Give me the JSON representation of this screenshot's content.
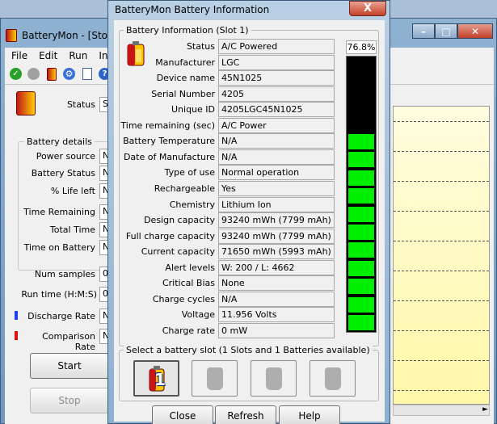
{
  "main": {
    "title": "BatteryMon - [Stop",
    "menu": [
      "File",
      "Edit",
      "Run",
      "Info"
    ],
    "status_label": "Status",
    "status_value": "S",
    "details_legend": "Battery details",
    "fields": [
      {
        "label": "Power source",
        "value": "N"
      },
      {
        "label": "Battery Status",
        "value": "N"
      },
      {
        "label": "% Life left",
        "value": "N"
      },
      {
        "label": "Time Remaining",
        "value": "N"
      },
      {
        "label": "Total Time",
        "value": "N"
      },
      {
        "label": "Time on Battery",
        "value": "N"
      }
    ],
    "num_samples_label": "Num samples",
    "num_samples_value": "0",
    "run_time_label": "Run time (H:M:S)",
    "run_time_value": "0",
    "discharge_label": "Discharge Rate",
    "discharge_value": "N",
    "comparison_label": "Comparison Rate",
    "comparison_value": "N",
    "start_label": "Start",
    "stop_label": "Stop",
    "discharge_color": "#1f3fff",
    "comparison_color": "#e01010"
  },
  "dialog": {
    "title": "BatteryMon Battery Information",
    "close_glyph": "X",
    "info_legend": "Battery Information (Slot 1)",
    "charge_percent_text": "76.8%",
    "charge_fraction": 0.768,
    "rows": [
      {
        "label": "Status",
        "value": "A/C Powered"
      },
      {
        "label": "Manufacturer",
        "value": "LGC"
      },
      {
        "label": "Device name",
        "value": "45N1025"
      },
      {
        "label": "Serial Number",
        "value": "4205"
      },
      {
        "label": "Unique ID",
        "value": "4205LGC45N1025"
      },
      {
        "label": "Time remaining (sec)",
        "value": "A/C Power"
      },
      {
        "label": "Battery Temperature",
        "value": "N/A"
      },
      {
        "label": "Date of Manufacture",
        "value": "N/A"
      },
      {
        "label": "Type of use",
        "value": "Normal operation"
      },
      {
        "label": "Rechargeable",
        "value": "Yes"
      },
      {
        "label": "Chemistry",
        "value": "Lithium Ion"
      },
      {
        "label": "Design capacity",
        "value": "93240 mWh (7799 mAh)"
      },
      {
        "label": "Full charge capacity",
        "value": "93240 mWh (7799 mAh)"
      },
      {
        "label": "Current capacity",
        "value": "71650 mWh (5993 mAh)"
      },
      {
        "label": "Alert levels",
        "value": "W: 200 / L: 4662"
      },
      {
        "label": "Critical Bias",
        "value": "None"
      },
      {
        "label": "Charge cycles",
        "value": "N/A"
      },
      {
        "label": "Voltage",
        "value": "11.956 Volts"
      },
      {
        "label": "Charge rate",
        "value": "0 mW"
      }
    ],
    "slot_legend": "Select a battery slot (1 Slots and 1 Batteries available)",
    "slot_1_number": "1",
    "buttons": {
      "close": "Close",
      "refresh": "Refresh",
      "help": "Help"
    }
  }
}
